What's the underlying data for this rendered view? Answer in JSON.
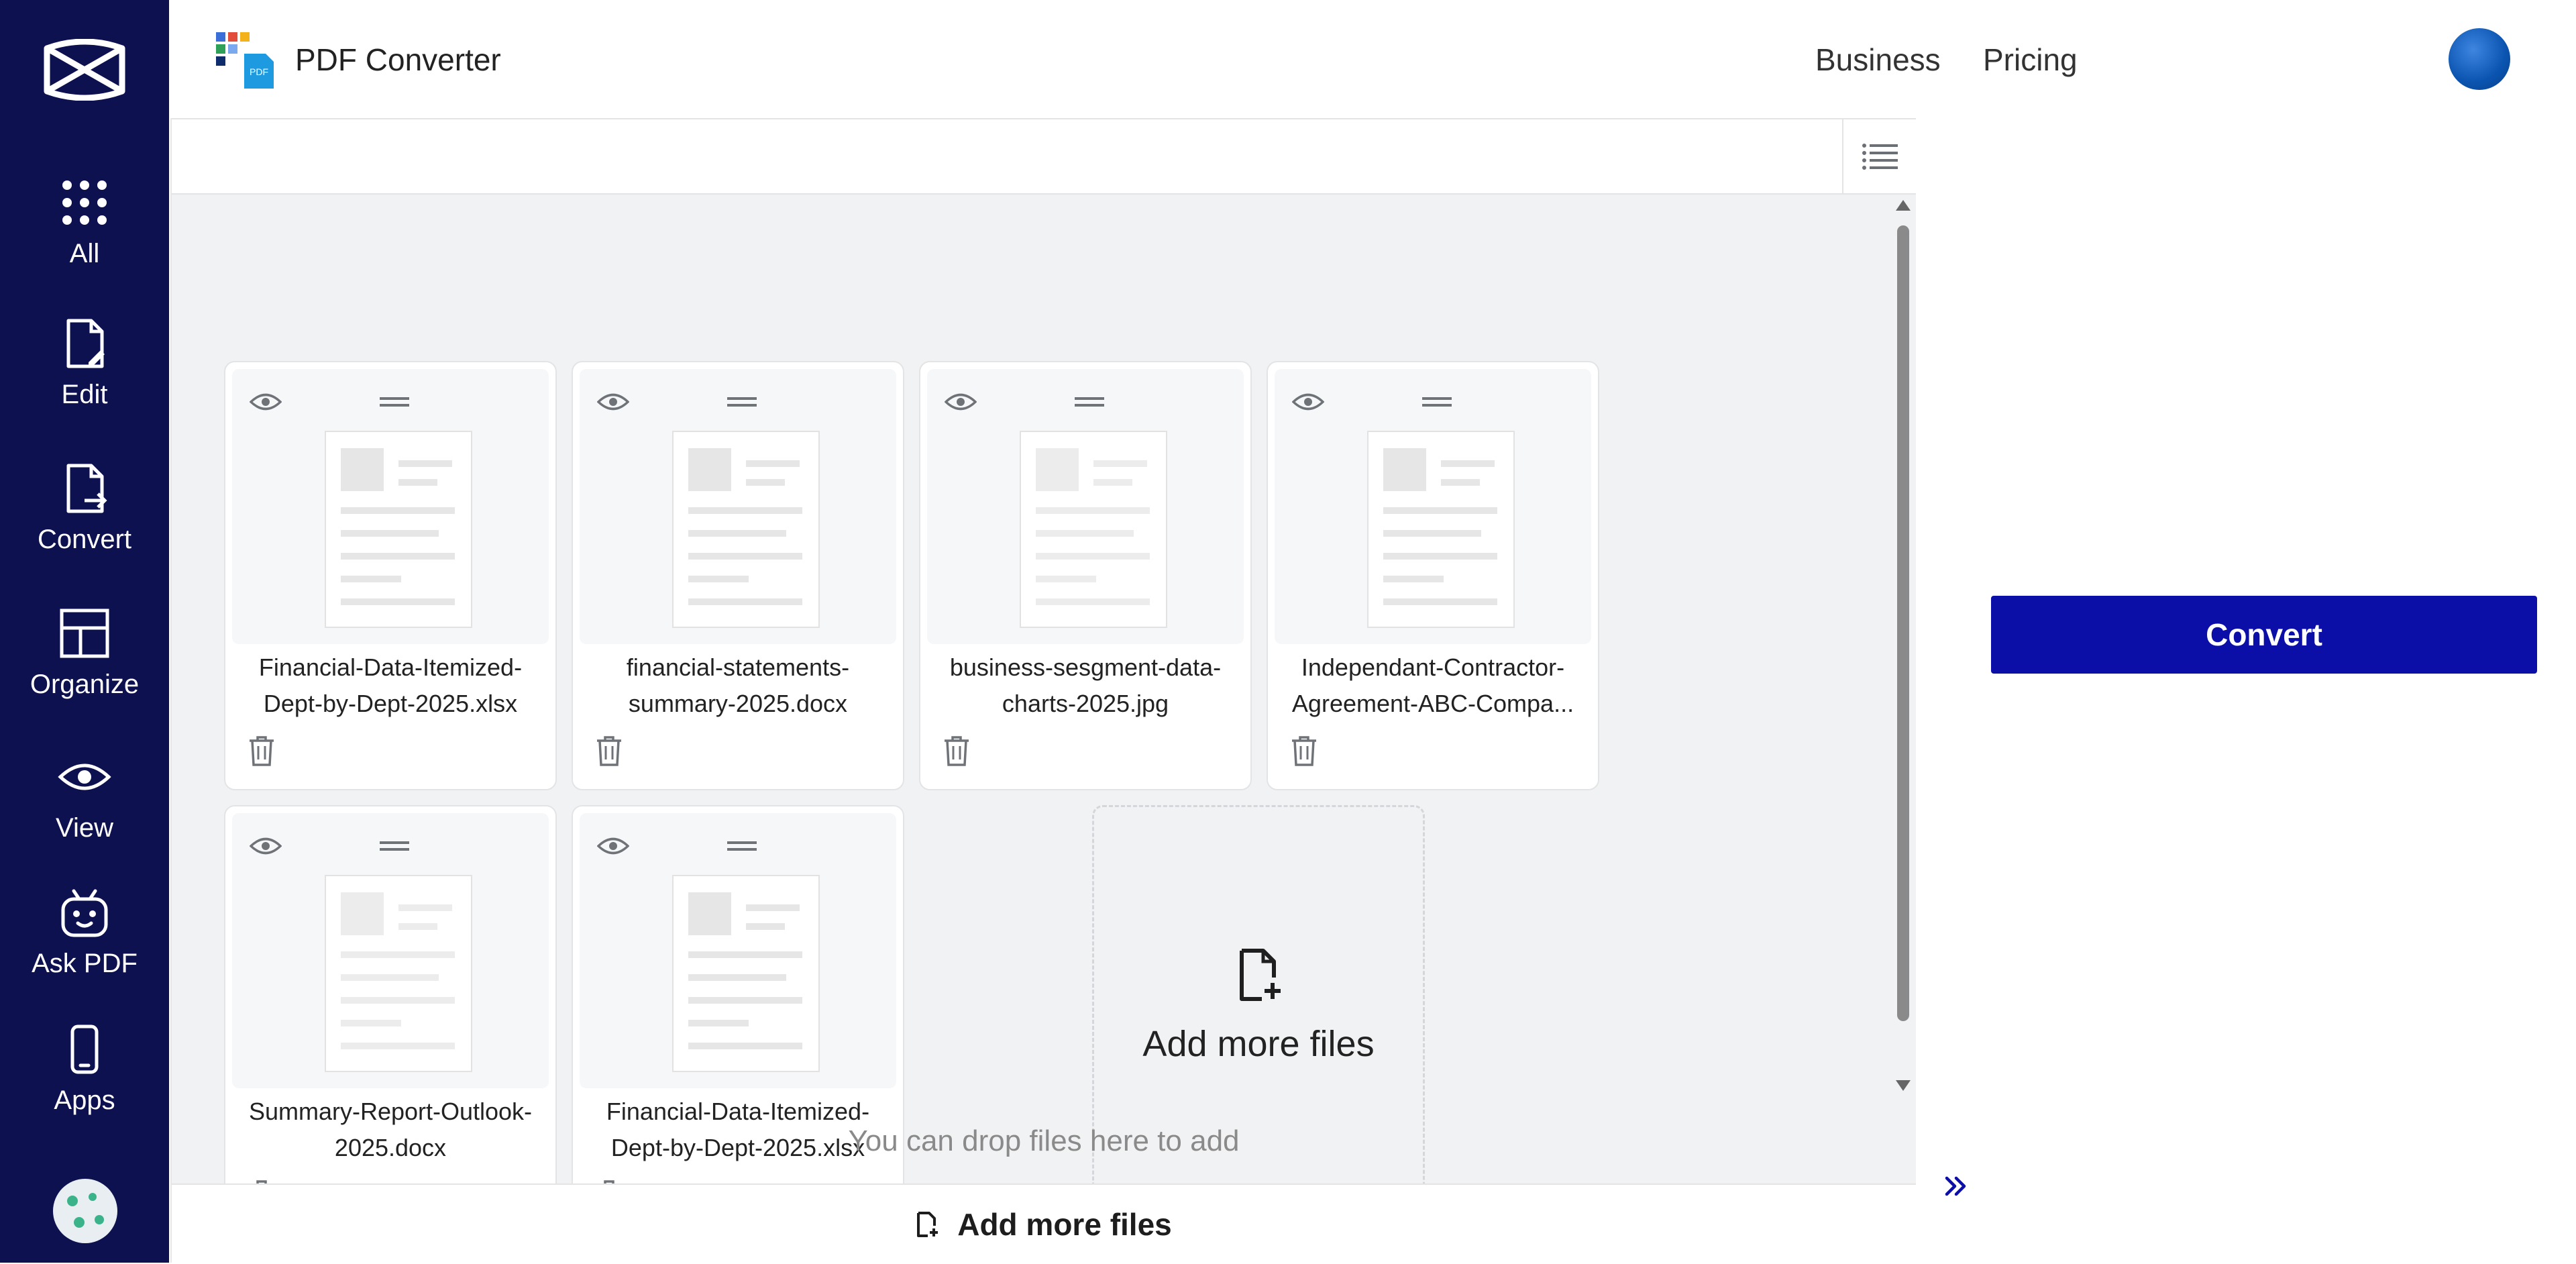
{
  "sidebar": {
    "items": [
      {
        "label": "All",
        "icon": "grid-icon"
      },
      {
        "label": "Edit",
        "icon": "edit-file-icon"
      },
      {
        "label": "Convert",
        "icon": "convert-file-icon"
      },
      {
        "label": "Organize",
        "icon": "layout-icon"
      },
      {
        "label": "View",
        "icon": "eye-icon"
      },
      {
        "label": "Ask PDF",
        "icon": "robot-icon"
      },
      {
        "label": "Apps",
        "icon": "phone-icon"
      }
    ]
  },
  "header": {
    "app_name": "PDF Converter",
    "links": [
      "Business",
      "Pricing"
    ]
  },
  "files": [
    {
      "line1": "Financial-Data-Itemized-",
      "line2": "Dept-by-Dept-2025.xlsx"
    },
    {
      "line1": "financial-statements-",
      "line2": "summary-2025.docx"
    },
    {
      "line1": "business-sesgment-data-",
      "line2": "charts-2025.jpg"
    },
    {
      "line1": "Independant-Contractor-",
      "line2": "Agreement-ABC-Compa..."
    },
    {
      "line1": "Summary-Report-Outlook-",
      "line2": "2025.docx"
    },
    {
      "line1": "Financial-Data-Itemized-",
      "line2": "Dept-by-Dept-2025.xlsx"
    }
  ],
  "add_card": {
    "label": "Add more files"
  },
  "drop_hint": "You can drop files here to add",
  "bottom_bar": {
    "label": "Add more files"
  },
  "convert_button": {
    "label": "Convert"
  },
  "colors": {
    "sidebar_bg": "#0d1150",
    "convert_bg": "#0b0fa8",
    "panel_bg": "#f1f2f3"
  }
}
